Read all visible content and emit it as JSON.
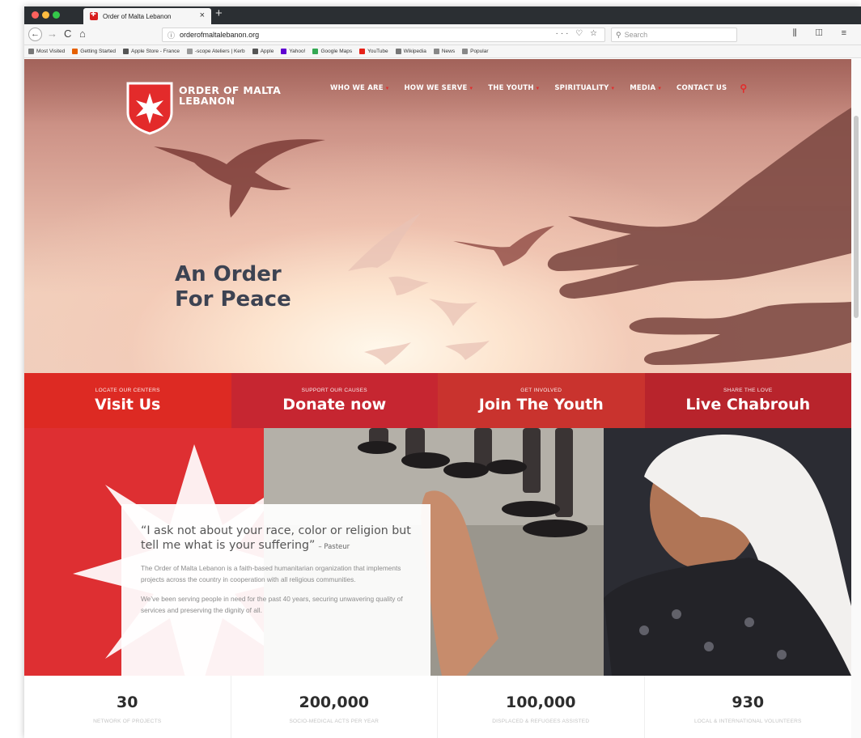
{
  "browser": {
    "tab_title": "Order of Malta Lebanon",
    "tab_close": "×",
    "new_tab": "+",
    "url": "orderofmaltalebanon.org",
    "url_info": "ⓘ",
    "url_tools": "··· ♡ ☆",
    "search_placeholder": "Search",
    "nav_right": "⫼ ◫ ≡",
    "back": "←",
    "forward": "→",
    "reload": "C",
    "home": "⌂",
    "bookmarks": [
      {
        "label": "Most Visited",
        "color": "#777777"
      },
      {
        "label": "Getting Started",
        "color": "#e66000"
      },
      {
        "label": "Apple Store - France",
        "color": "#555555"
      },
      {
        "label": "-scope Ateliers | Kerb",
        "color": "#999999"
      },
      {
        "label": "Apple",
        "color": "#555555"
      },
      {
        "label": "Yahoo!",
        "color": "#5f01d1"
      },
      {
        "label": "Google Maps",
        "color": "#34a853"
      },
      {
        "label": "YouTube",
        "color": "#e62117"
      },
      {
        "label": "Wikipedia",
        "color": "#777777"
      },
      {
        "label": "News",
        "color": "#888888"
      },
      {
        "label": "Popular",
        "color": "#888888"
      }
    ]
  },
  "site": {
    "logo_line1": "ORDER OF MALTA",
    "logo_line2": "LEBANON",
    "nav": [
      {
        "label": "WHO WE ARE",
        "caret": "▾"
      },
      {
        "label": "HOW WE SERVE",
        "caret": "▾"
      },
      {
        "label": "THE YOUTH",
        "caret": "▾"
      },
      {
        "label": "SPIRITUALITY",
        "caret": "▾"
      },
      {
        "label": "MEDIA",
        "caret": "▾"
      },
      {
        "label": "CONTACT US",
        "caret": ""
      }
    ],
    "search_icon": "⚲",
    "hero_line1": "An Order",
    "hero_line2": "For Peace"
  },
  "cta": [
    {
      "small": "LOCATE OUR CENTERS",
      "big": "Visit Us",
      "color": "#dd2a23"
    },
    {
      "small": "SUPPORT OUR CAUSES",
      "big": "Donate now",
      "color": "#c62631"
    },
    {
      "small": "GET INVOLVED",
      "big": "Join The Youth",
      "color": "#c9332e"
    },
    {
      "small": "SHARE THE LOVE",
      "big": "Live Chabrouh",
      "color": "#b8242c"
    }
  ],
  "story": {
    "quote": "“I ask not about your race, color or religion but tell me what is your suffering”",
    "attribution": "– Pasteur",
    "para1": "The Order of Malta Lebanon is a faith-based humanitarian organization that implements projects across the country in cooperation with all religious communities.",
    "para2": "We’ve been serving people in need for the past 40 years, securing unwavering quality of services and preserving the dignity of all."
  },
  "stats": [
    {
      "number": "30",
      "label": "NETWORK OF PROJECTS"
    },
    {
      "number": "200,000",
      "label": "SOCIO-MEDICAL ACTS PER YEAR"
    },
    {
      "number": "100,000",
      "label": "DISPLACED & REFUGEES ASSISTED"
    },
    {
      "number": "930",
      "label": "LOCAL & INTERNATIONAL VOLUNTEERS"
    }
  ],
  "colors": {
    "brand_red": "#e32b2b",
    "headline": "#3d4352"
  }
}
